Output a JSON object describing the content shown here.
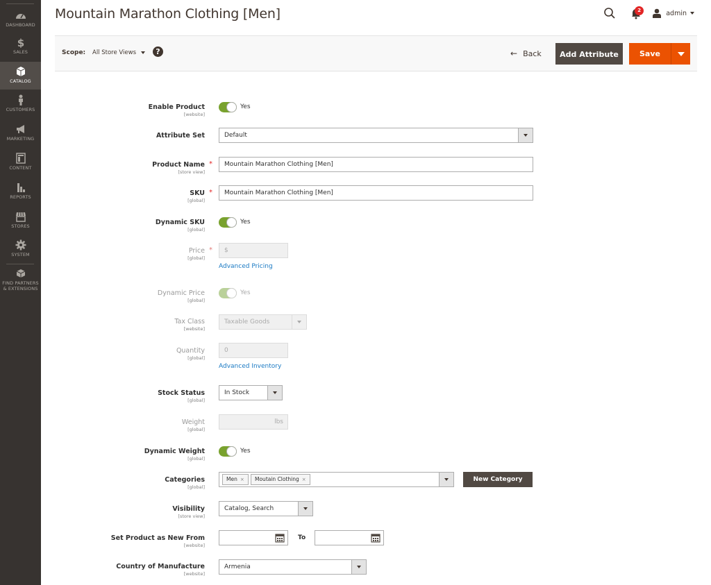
{
  "sidebar": {
    "items": [
      {
        "label": "DASHBOARD",
        "icon": "dashboard-icon"
      },
      {
        "label": "SALES",
        "icon": "dollar-icon"
      },
      {
        "label": "CATALOG",
        "icon": "box-icon",
        "active": true
      },
      {
        "label": "CUSTOMERS",
        "icon": "person-icon"
      },
      {
        "label": "MARKETING",
        "icon": "megaphone-icon"
      },
      {
        "label": "CONTENT",
        "icon": "layout-icon"
      },
      {
        "label": "REPORTS",
        "icon": "bar-chart-icon"
      },
      {
        "label": "STORES",
        "icon": "storefront-icon"
      },
      {
        "label": "SYSTEM",
        "icon": "gear-icon"
      },
      {
        "label": "FIND PARTNERS & EXTENSIONS",
        "icon": "blocks-icon"
      }
    ]
  },
  "header": {
    "title": "Mountain Marathon Clothing [Men]",
    "notifications_count": "2",
    "user": "admin"
  },
  "toolbar": {
    "scope_label": "Scope:",
    "scope_value": "All Store Views",
    "help": "?",
    "back": "Back",
    "add_attribute": "Add Attribute",
    "save": "Save"
  },
  "colors": {
    "sidebar_bg": "#373330",
    "accent_orange": "#eb5202",
    "toggle_green": "#79a22e",
    "link_blue": "#1979c3",
    "dark_button": "#514943"
  },
  "form": {
    "enable_product": {
      "label": "Enable Product",
      "scope": "[website]",
      "value": "Yes"
    },
    "attribute_set": {
      "label": "Attribute Set",
      "value": "Default"
    },
    "product_name": {
      "label": "Product Name",
      "scope": "[store view]",
      "value": "Mountain Marathon Clothing [Men]",
      "required": "*"
    },
    "sku": {
      "label": "SKU",
      "scope": "[global]",
      "value": "Mountain Marathon Clothing [Men]",
      "required": "*"
    },
    "dynamic_sku": {
      "label": "Dynamic SKU",
      "scope": "[global]",
      "value": "Yes"
    },
    "price": {
      "label": "Price",
      "scope": "[global]",
      "value": "$",
      "required": "*",
      "link": "Advanced Pricing"
    },
    "dynamic_price": {
      "label": "Dynamic Price",
      "scope": "[global]",
      "value": "Yes"
    },
    "tax_class": {
      "label": "Tax Class",
      "scope": "[website]",
      "value": "Taxable Goods"
    },
    "quantity": {
      "label": "Quantity",
      "scope": "[global]",
      "value": "0",
      "link": "Advanced Inventory"
    },
    "stock_status": {
      "label": "Stock Status",
      "scope": "[global]",
      "value": "In Stock"
    },
    "weight": {
      "label": "Weight",
      "scope": "[global]",
      "unit": "lbs"
    },
    "dynamic_weight": {
      "label": "Dynamic Weight",
      "scope": "[global]",
      "value": "Yes"
    },
    "categories": {
      "label": "Categories",
      "scope": "[global]",
      "chips": [
        "Men",
        "Moutain Clothing"
      ],
      "remove": "×",
      "new_button": "New Category"
    },
    "visibility": {
      "label": "Visibility",
      "scope": "[store view]",
      "value": "Catalog, Search"
    },
    "new_from": {
      "label": "Set Product as New From",
      "scope": "[website]",
      "to_label": "To",
      "from_value": "",
      "to_value": ""
    },
    "country": {
      "label": "Country of Manufacture",
      "scope": "[website]",
      "value": "Armenia"
    }
  }
}
